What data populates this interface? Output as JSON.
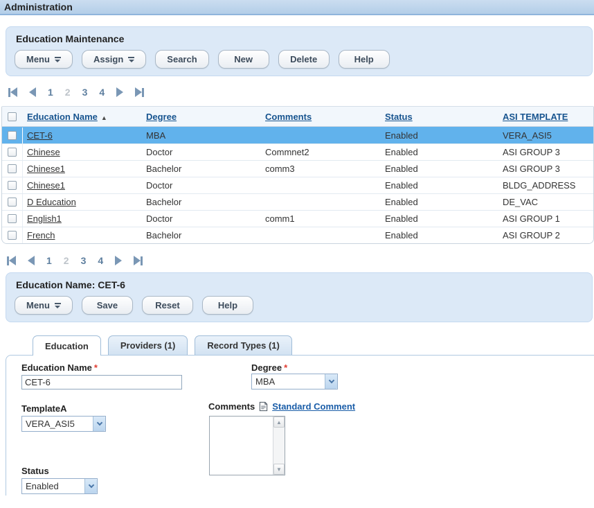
{
  "header": {
    "title": "Administration"
  },
  "maintenance_panel": {
    "title": "Education Maintenance",
    "menu_button": "Menu",
    "assign_button": "Assign",
    "search_button": "Search",
    "new_button": "New",
    "delete_button": "Delete",
    "help_button": "Help"
  },
  "pagination": {
    "pages": [
      "1",
      "2",
      "3",
      "4"
    ],
    "current_page": "2"
  },
  "table": {
    "headers": {
      "education_name": "Education Name",
      "degree": "Degree",
      "comments": "Comments",
      "status": "Status",
      "asi_template": "ASI TEMPLATE"
    },
    "sort": {
      "column": "Education Name",
      "direction": "ascending"
    },
    "rows": [
      {
        "name": "CET-6",
        "degree": "MBA",
        "comments": "",
        "status": "Enabled",
        "asi_template": "VERA_ASI5",
        "selected": true
      },
      {
        "name": "Chinese",
        "degree": "Doctor",
        "comments": "Commnet2",
        "status": "Enabled",
        "asi_template": "ASI GROUP 3",
        "selected": false
      },
      {
        "name": "Chinese1",
        "degree": "Bachelor",
        "comments": "comm3",
        "status": "Enabled",
        "asi_template": "ASI GROUP 3",
        "selected": false
      },
      {
        "name": "Chinese1",
        "degree": "Doctor",
        "comments": "",
        "status": "Enabled",
        "asi_template": "BLDG_ADDRESS",
        "selected": false
      },
      {
        "name": "D Education",
        "degree": "Bachelor",
        "comments": "",
        "status": "Enabled",
        "asi_template": "DE_VAC",
        "selected": false
      },
      {
        "name": "English1",
        "degree": "Doctor",
        "comments": "comm1",
        "status": "Enabled",
        "asi_template": "ASI GROUP 1",
        "selected": false
      },
      {
        "name": "French",
        "degree": "Bachelor",
        "comments": "",
        "status": "Enabled",
        "asi_template": "ASI GROUP 2",
        "selected": false
      }
    ]
  },
  "detail_panel": {
    "title": "Education Name: CET-6",
    "menu_button": "Menu",
    "save_button": "Save",
    "reset_button": "Reset",
    "help_button": "Help"
  },
  "tabs": {
    "education": "Education",
    "providers": "Providers (1)",
    "record_types": "Record Types (1)",
    "active_tab": "Education"
  },
  "form": {
    "required_marker": "*",
    "education_name": {
      "label": "Education Name",
      "value": "CET-6"
    },
    "degree": {
      "label": "Degree",
      "value": "MBA"
    },
    "template": {
      "label": "TemplateA",
      "value": "VERA_ASI5"
    },
    "comments": {
      "label": "Comments",
      "link_label": "Standard Comment",
      "value": ""
    },
    "status": {
      "label": "Status",
      "value": "Enabled"
    }
  },
  "icons": {
    "sort_ascending": "▲",
    "scroll_up": "▲",
    "scroll_down": "▼"
  },
  "colors": {
    "selected_row": "#61B2EC",
    "panel_background": "#DCE9F7",
    "table_header_link": "#17548F",
    "link_blue": "#1A5DA8"
  }
}
